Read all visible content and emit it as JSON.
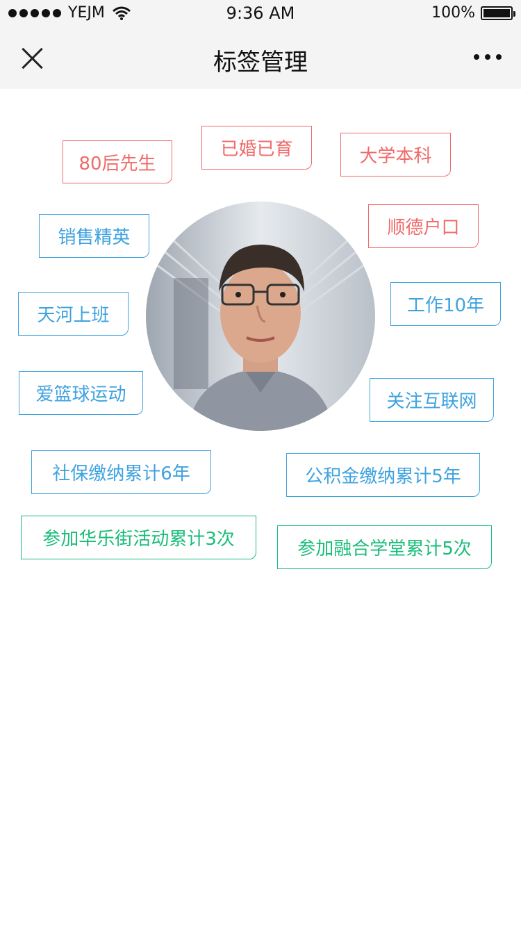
{
  "status_bar": {
    "carrier": "YEJM",
    "time": "9:36 AM",
    "battery": "100%"
  },
  "nav": {
    "title": "标签管理"
  },
  "tags": {
    "t1": "80后先生",
    "t2": "已婚已育",
    "t3": "大学本科",
    "t4": "销售精英",
    "t5": "顺德户口",
    "t6": "天河上班",
    "t7": "工作10年",
    "t8": "爱篮球运动",
    "t9": "关注互联网",
    "t10": "社保缴纳累计6年",
    "t11": "公积金缴纳累计5年",
    "t12": "参加华乐街活动累计3次",
    "t13": "参加融合学堂累计5次"
  },
  "colors": {
    "red": "#f06a6a",
    "blue": "#3fa3e0",
    "green": "#19bd7a"
  },
  "icons": [
    "close-icon",
    "more-icon",
    "wifi-icon",
    "battery-icon"
  ]
}
